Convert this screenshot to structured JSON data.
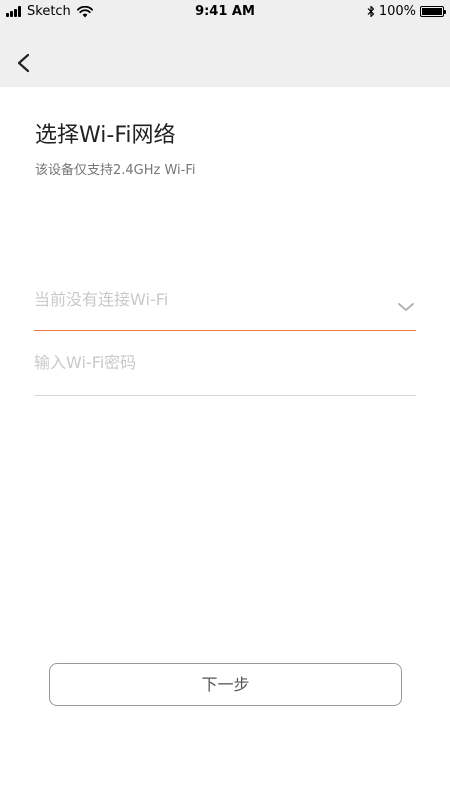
{
  "status_bar": {
    "carrier": "Sketch",
    "time": "9:41 AM",
    "battery": "100%"
  },
  "nav": {
    "back_icon": "chevron-left-icon"
  },
  "page": {
    "title": "选择Wi-Fi网络",
    "subtitle": "该设备仅支持2.4GHz Wi-Fi"
  },
  "wifi_select": {
    "value": "当前没有连接Wi-Fi",
    "icon": "chevron-down-icon"
  },
  "password": {
    "placeholder": "输入Wi-Fi密码",
    "value": ""
  },
  "next_button": {
    "label": "下一步"
  },
  "colors": {
    "accent": "#f0794d",
    "header_bg": "#efefef",
    "placeholder": "#c9c9c9"
  }
}
